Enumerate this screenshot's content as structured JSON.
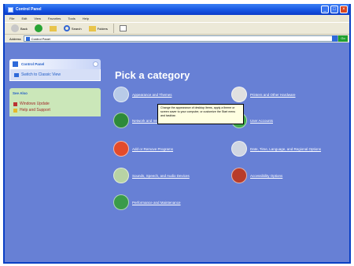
{
  "window": {
    "title": "Control Panel"
  },
  "menubar": {
    "items": [
      "File",
      "Edit",
      "View",
      "Favorites",
      "Tools",
      "Help"
    ]
  },
  "toolbar": {
    "back_label": "Back",
    "search_label": "Search",
    "folders_label": "Folders"
  },
  "addressbar": {
    "label": "Address",
    "value": "Control Panel",
    "go_label": "Go"
  },
  "taskpane": {
    "control_panel": {
      "title": "Control Panel",
      "link": "Switch to Classic View"
    },
    "see_also": {
      "title": "See Also",
      "links": [
        "Windows Update",
        "Help and Support"
      ]
    }
  },
  "main": {
    "heading": "Pick a category"
  },
  "categories": [
    {
      "label": "Appearance and Themes",
      "color": "#b8cbe8"
    },
    {
      "label": "Network and Internet Connections",
      "color": "#2d8a3a"
    },
    {
      "label": "Add or Remove Programs",
      "color": "#e34b2b"
    },
    {
      "label": "Sounds, Speech, and Audio Devices",
      "color": "#b8d3a4"
    },
    {
      "label": "Date, Time, Language, and Regional Options",
      "color": "#d0d6e2"
    },
    {
      "label": "Performance and Maintenance",
      "color": "#3a9b4a"
    },
    {
      "label": "Printers and Other Hardware",
      "color": "#e0e0e0"
    },
    {
      "label": "Accessibility Options",
      "color": "#b83c2a"
    },
    {
      "label": "User Accounts",
      "color": "#3fa84c"
    }
  ],
  "tooltip": {
    "text": "Change the appearance of desktop items, apply a theme or screen saver to your computer, or customize the Start menu and taskbar."
  }
}
